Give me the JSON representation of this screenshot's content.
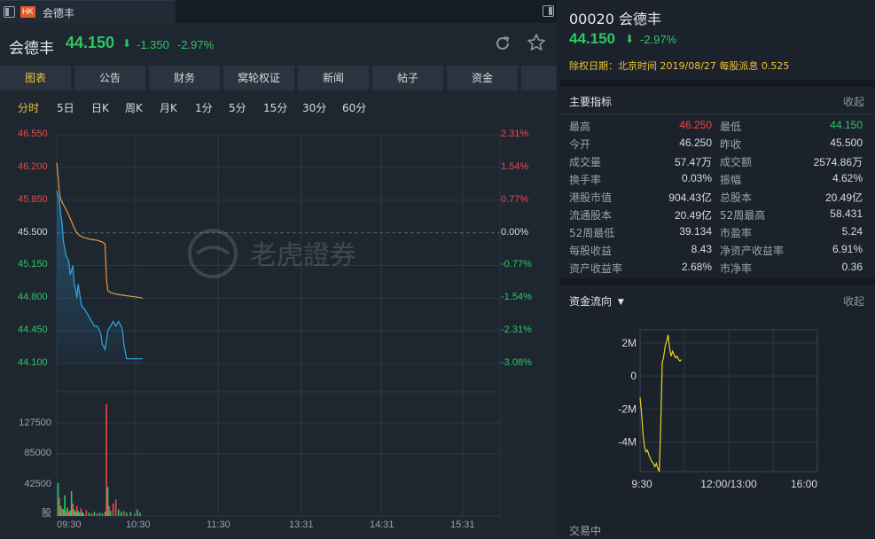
{
  "tab": {
    "market_badge": "HK",
    "title": "会德丰"
  },
  "quote": {
    "name": "会德丰",
    "price": "44.150",
    "arrow": "⬇",
    "change": "-1.350",
    "change_pct": "-2.97%"
  },
  "main_tabs": [
    "图表",
    "公告",
    "财务",
    "窝轮权证",
    "新闻",
    "帖子",
    "资金"
  ],
  "period_tabs": [
    "分时",
    "5日",
    "日K",
    "周K",
    "月K",
    "1分",
    "5分",
    "15分",
    "30分",
    "60分"
  ],
  "colors": {
    "up": "#f04848",
    "down": "#2ec766",
    "active": "#f0c330",
    "price_line": "#e89a3c",
    "avg_line": "#2fa6e8"
  },
  "chart_data": {
    "type": "line",
    "prev_close": 45.5,
    "y_ticks": [
      "46.550",
      "46.200",
      "45.850",
      "45.500",
      "45.150",
      "44.800",
      "44.450",
      "44.100"
    ],
    "y_ticks_pct": [
      "2.31%",
      "1.54%",
      "0.77%",
      "0.00%",
      "-0.77%",
      "-1.54%",
      "-2.31%",
      "-3.08%"
    ],
    "ylim": [
      44.1,
      46.55
    ],
    "x_ticks": [
      "09:30",
      "10:30",
      "11:30",
      "13:31",
      "14:31",
      "15:31"
    ],
    "watermark": "老虎證券",
    "series": [
      {
        "color_key": "price_line",
        "x": [
          0,
          2,
          4,
          6,
          10,
          16,
          22,
          26,
          30,
          34,
          40,
          50,
          60,
          68,
          72,
          74,
          76,
          80,
          90,
          100,
          110,
          120,
          128
        ],
        "values": [
          46.25,
          46.1,
          45.93,
          45.86,
          45.8,
          45.72,
          45.62,
          45.55,
          45.5,
          45.47,
          45.45,
          45.43,
          45.42,
          45.4,
          45.38,
          45.0,
          44.88,
          44.86,
          44.84,
          44.83,
          44.82,
          44.81,
          44.8
        ]
      },
      {
        "color_key": "avg_line",
        "x": [
          0,
          2,
          4,
          6,
          8,
          10,
          14,
          18,
          20,
          22,
          24,
          26,
          28,
          30,
          32,
          34,
          36,
          38,
          40,
          44,
          48,
          52,
          56,
          60,
          64,
          66,
          68,
          70,
          72,
          74,
          76,
          80,
          84,
          88,
          92,
          96,
          98,
          100,
          104,
          110,
          120,
          128
        ],
        "values": [
          45.95,
          45.9,
          45.85,
          45.7,
          45.6,
          45.4,
          45.25,
          45.2,
          45.05,
          45.1,
          45.15,
          44.95,
          44.9,
          44.8,
          44.95,
          44.85,
          44.75,
          44.7,
          44.7,
          44.65,
          44.6,
          44.55,
          44.5,
          44.5,
          44.45,
          44.4,
          44.3,
          44.28,
          44.25,
          44.35,
          44.45,
          44.5,
          44.55,
          44.5,
          44.55,
          44.5,
          44.45,
          44.3,
          44.15,
          44.15,
          44.15,
          44.15
        ]
      }
    ],
    "volume": {
      "y_ticks": [
        "127500",
        "85000",
        "42500",
        "股"
      ],
      "ylim": [
        0,
        150000
      ],
      "bars": [
        {
          "x": 2,
          "v": 40000,
          "dir": "down"
        },
        {
          "x": 4,
          "v": 22000,
          "dir": "up"
        },
        {
          "x": 6,
          "v": 12000,
          "dir": "down"
        },
        {
          "x": 8,
          "v": 9000,
          "dir": "up"
        },
        {
          "x": 10,
          "v": 8000,
          "dir": "down"
        },
        {
          "x": 12,
          "v": 25000,
          "dir": "down"
        },
        {
          "x": 14,
          "v": 6000,
          "dir": "up"
        },
        {
          "x": 16,
          "v": 10000,
          "dir": "down"
        },
        {
          "x": 18,
          "v": 5000,
          "dir": "up"
        },
        {
          "x": 20,
          "v": 7000,
          "dir": "down"
        },
        {
          "x": 22,
          "v": 30000,
          "dir": "down"
        },
        {
          "x": 24,
          "v": 15000,
          "dir": "up"
        },
        {
          "x": 26,
          "v": 8000,
          "dir": "down"
        },
        {
          "x": 28,
          "v": 5000,
          "dir": "down"
        },
        {
          "x": 30,
          "v": 12000,
          "dir": "up"
        },
        {
          "x": 32,
          "v": 6000,
          "dir": "down"
        },
        {
          "x": 34,
          "v": 4000,
          "dir": "down"
        },
        {
          "x": 36,
          "v": 9000,
          "dir": "up"
        },
        {
          "x": 38,
          "v": 5000,
          "dir": "down"
        },
        {
          "x": 40,
          "v": 3000,
          "dir": "down"
        },
        {
          "x": 44,
          "v": 7000,
          "dir": "up"
        },
        {
          "x": 48,
          "v": 4000,
          "dir": "down"
        },
        {
          "x": 52,
          "v": 3000,
          "dir": "down"
        },
        {
          "x": 56,
          "v": 5000,
          "dir": "down"
        },
        {
          "x": 60,
          "v": 3000,
          "dir": "up"
        },
        {
          "x": 64,
          "v": 4000,
          "dir": "down"
        },
        {
          "x": 68,
          "v": 3000,
          "dir": "down"
        },
        {
          "x": 72,
          "v": 5000,
          "dir": "down"
        },
        {
          "x": 74,
          "v": 135000,
          "dir": "up"
        },
        {
          "x": 76,
          "v": 35000,
          "dir": "down"
        },
        {
          "x": 78,
          "v": 12000,
          "dir": "up"
        },
        {
          "x": 80,
          "v": 6000,
          "dir": "down"
        },
        {
          "x": 84,
          "v": 15000,
          "dir": "up"
        },
        {
          "x": 88,
          "v": 20000,
          "dir": "up"
        },
        {
          "x": 92,
          "v": 8000,
          "dir": "down"
        },
        {
          "x": 96,
          "v": 5000,
          "dir": "down"
        },
        {
          "x": 100,
          "v": 6000,
          "dir": "up"
        },
        {
          "x": 104,
          "v": 4000,
          "dir": "down"
        },
        {
          "x": 110,
          "v": 5000,
          "dir": "down"
        },
        {
          "x": 116,
          "v": 3000,
          "dir": "up"
        },
        {
          "x": 120,
          "v": 8000,
          "dir": "down"
        },
        {
          "x": 124,
          "v": 4000,
          "dir": "down"
        }
      ]
    },
    "grid": true
  },
  "right": {
    "code_name": "00020 会德丰",
    "price": "44.150",
    "arrow": "⬇",
    "change_pct": "-2.97%",
    "dividend": "除权日期：北京时间 2019/08/27 每股派息 0.525",
    "indicators_title": "主要指标",
    "collapse": "收起",
    "indicators": [
      [
        {
          "label": "最高",
          "value": "46.250",
          "tone": "up"
        },
        {
          "label": "最低",
          "value": "44.150",
          "tone": "down"
        }
      ],
      [
        {
          "label": "今开",
          "value": "46.250",
          "tone": "plain"
        },
        {
          "label": "昨收",
          "value": "45.500",
          "tone": "plain"
        }
      ],
      [
        {
          "label": "成交量",
          "value": "57.47万",
          "tone": "plain"
        },
        {
          "label": "成交额",
          "value": "2574.86万",
          "tone": "plain"
        }
      ],
      [
        {
          "label": "换手率",
          "value": "0.03%",
          "tone": "plain"
        },
        {
          "label": "振幅",
          "value": "4.62%",
          "tone": "plain"
        }
      ],
      [
        {
          "label": "港股市值",
          "value": "904.43亿",
          "tone": "plain"
        },
        {
          "label": "总股本",
          "value": "20.49亿",
          "tone": "plain"
        }
      ],
      [
        {
          "label": "流通股本",
          "value": "20.49亿",
          "tone": "plain"
        },
        {
          "label": "52周最高",
          "value": "58.431",
          "tone": "plain"
        }
      ],
      [
        {
          "label": "52周最低",
          "value": "39.134",
          "tone": "plain"
        },
        {
          "label": "市盈率",
          "value": "5.24",
          "tone": "plain"
        }
      ],
      [
        {
          "label": "每股收益",
          "value": "8.43",
          "tone": "plain"
        },
        {
          "label": "净资产收益率",
          "value": "6.91%",
          "tone": "plain"
        }
      ],
      [
        {
          "label": "资产收益率",
          "value": "2.68%",
          "tone": "plain"
        },
        {
          "label": "市净率",
          "value": "0.36",
          "tone": "plain"
        }
      ]
    ],
    "fund_flow_title": "资金流向",
    "fund_flow_collapse": "收起",
    "status": "交易中",
    "fund_chart": {
      "type": "line",
      "y_ticks": [
        "2M",
        "0",
        "-2M",
        "-4M"
      ],
      "x_ticks": [
        "9:30",
        "12:00/13:00",
        "16:00"
      ],
      "ylim": [
        -5.8,
        2.8
      ],
      "x": [
        0,
        1,
        2,
        3,
        4,
        5,
        6,
        7,
        8,
        9,
        10,
        11,
        12,
        13,
        14,
        15,
        16,
        17,
        18,
        19,
        20,
        21,
        22,
        23,
        24,
        25,
        26,
        27,
        28
      ],
      "values": [
        -1.3,
        -2.3,
        -3.5,
        -4.3,
        -4.6,
        -4.5,
        -4.8,
        -5.0,
        -5.2,
        -5.3,
        -5.5,
        -5.3,
        -5.6,
        -5.8,
        -3.0,
        0.8,
        1.2,
        1.8,
        2.1,
        2.5,
        1.7,
        1.2,
        1.5,
        1.3,
        1.1,
        1.2,
        1.0,
        0.9,
        1.0
      ],
      "line_color": "#e9d31c"
    }
  }
}
